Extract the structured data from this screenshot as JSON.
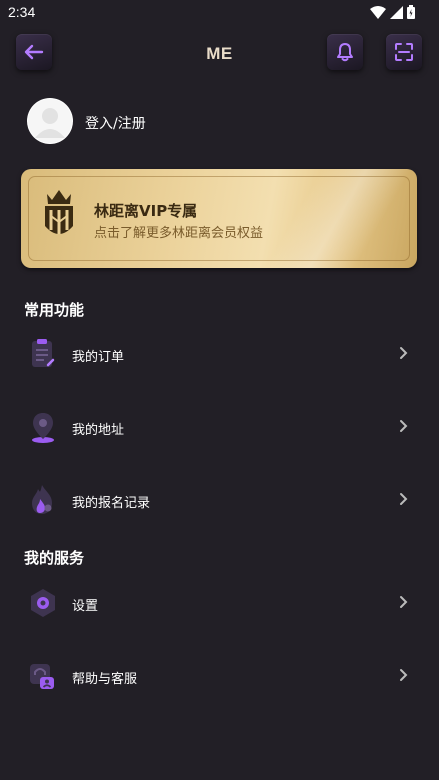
{
  "status_bar": {
    "time": "2:34"
  },
  "header": {
    "title": "ME",
    "back_icon": "arrow-left-icon",
    "bell_icon": "bell-icon",
    "scan_icon": "scan-icon"
  },
  "profile": {
    "login_label": "登入/注册",
    "avatar_icon": "user-placeholder-icon"
  },
  "vip": {
    "title": "林距离VIP专属",
    "subtitle": "点击了解更多林距离会员权益",
    "logo_icon": "crown-crest-icon"
  },
  "sections": {
    "common": {
      "heading": "常用功能",
      "items": [
        {
          "label": "我的订单",
          "icon": "clipboard-icon"
        },
        {
          "label": "我的地址",
          "icon": "location-pin-icon"
        },
        {
          "label": "我的报名记录",
          "icon": "flame-icon"
        }
      ]
    },
    "services": {
      "heading": "我的服务",
      "items": [
        {
          "label": "设置",
          "icon": "hexagon-gear-icon"
        },
        {
          "label": "帮助与客服",
          "icon": "headset-icon"
        }
      ]
    }
  },
  "colors": {
    "background": "#221f26",
    "accent": "#9b5cf0",
    "title": "#e9dcc9",
    "vip_gold": "#ecd39c"
  }
}
